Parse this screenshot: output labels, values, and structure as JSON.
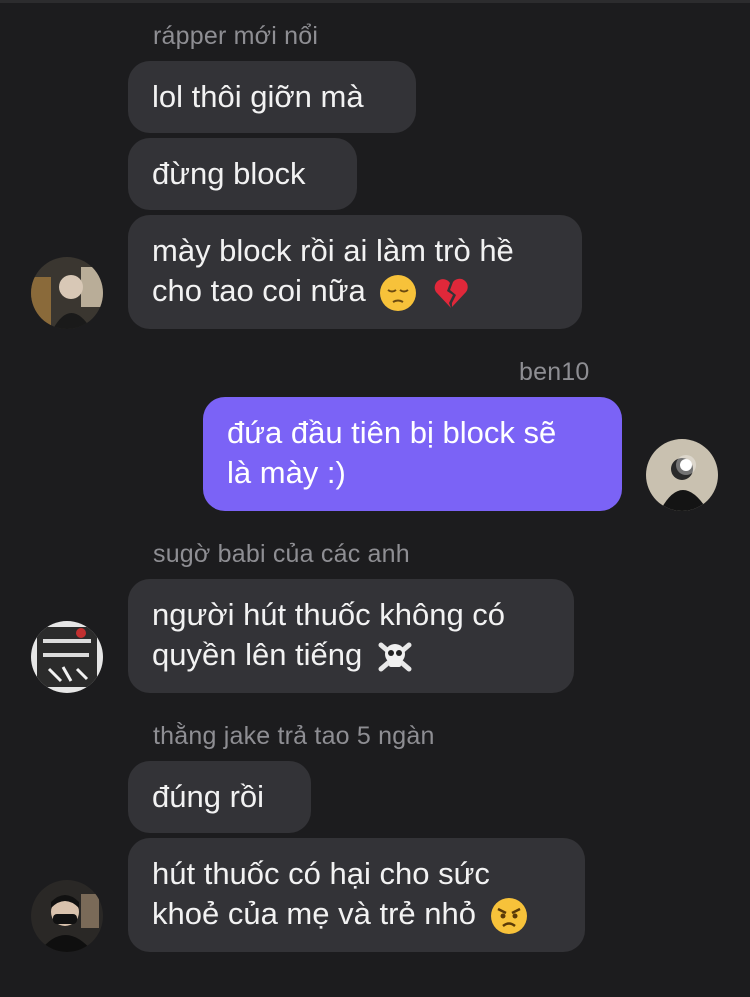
{
  "messages": [
    {
      "sender": "rápper mới nổi",
      "bubbles": [
        {
          "lines": [
            "lol thôi giỡn mà"
          ]
        },
        {
          "lines": [
            "đừng block"
          ]
        },
        {
          "lines": [
            "mày block rồi ai làm trò hề",
            "cho tao coi nữa"
          ],
          "emojis": [
            "pensive-face",
            "broken-heart"
          ]
        }
      ]
    },
    {
      "sender": "ben10",
      "bubbles": [
        {
          "lines": [
            "đứa đầu tiên bị block sẽ",
            "là mày :)"
          ]
        }
      ]
    },
    {
      "sender": "sugờ babi của các anh",
      "bubbles": [
        {
          "lines": [
            "người hút thuốc không có",
            "quyền lên tiếng"
          ],
          "emojis": [
            "skull-and-crossbones"
          ]
        }
      ]
    },
    {
      "sender": "thằng jake trả tao 5 ngàn",
      "bubbles": [
        {
          "lines": [
            "đúng rồi"
          ]
        },
        {
          "lines": [
            "hút thuốc có hại cho sức",
            "khoẻ của mẹ và trẻ nhỏ"
          ],
          "emojis": [
            "angry-face"
          ]
        }
      ]
    }
  ],
  "colors": {
    "background": "#1c1c1e",
    "bubble_incoming": "#333337",
    "bubble_outgoing": "#7b63f6",
    "sender_text": "#8e8e93"
  }
}
